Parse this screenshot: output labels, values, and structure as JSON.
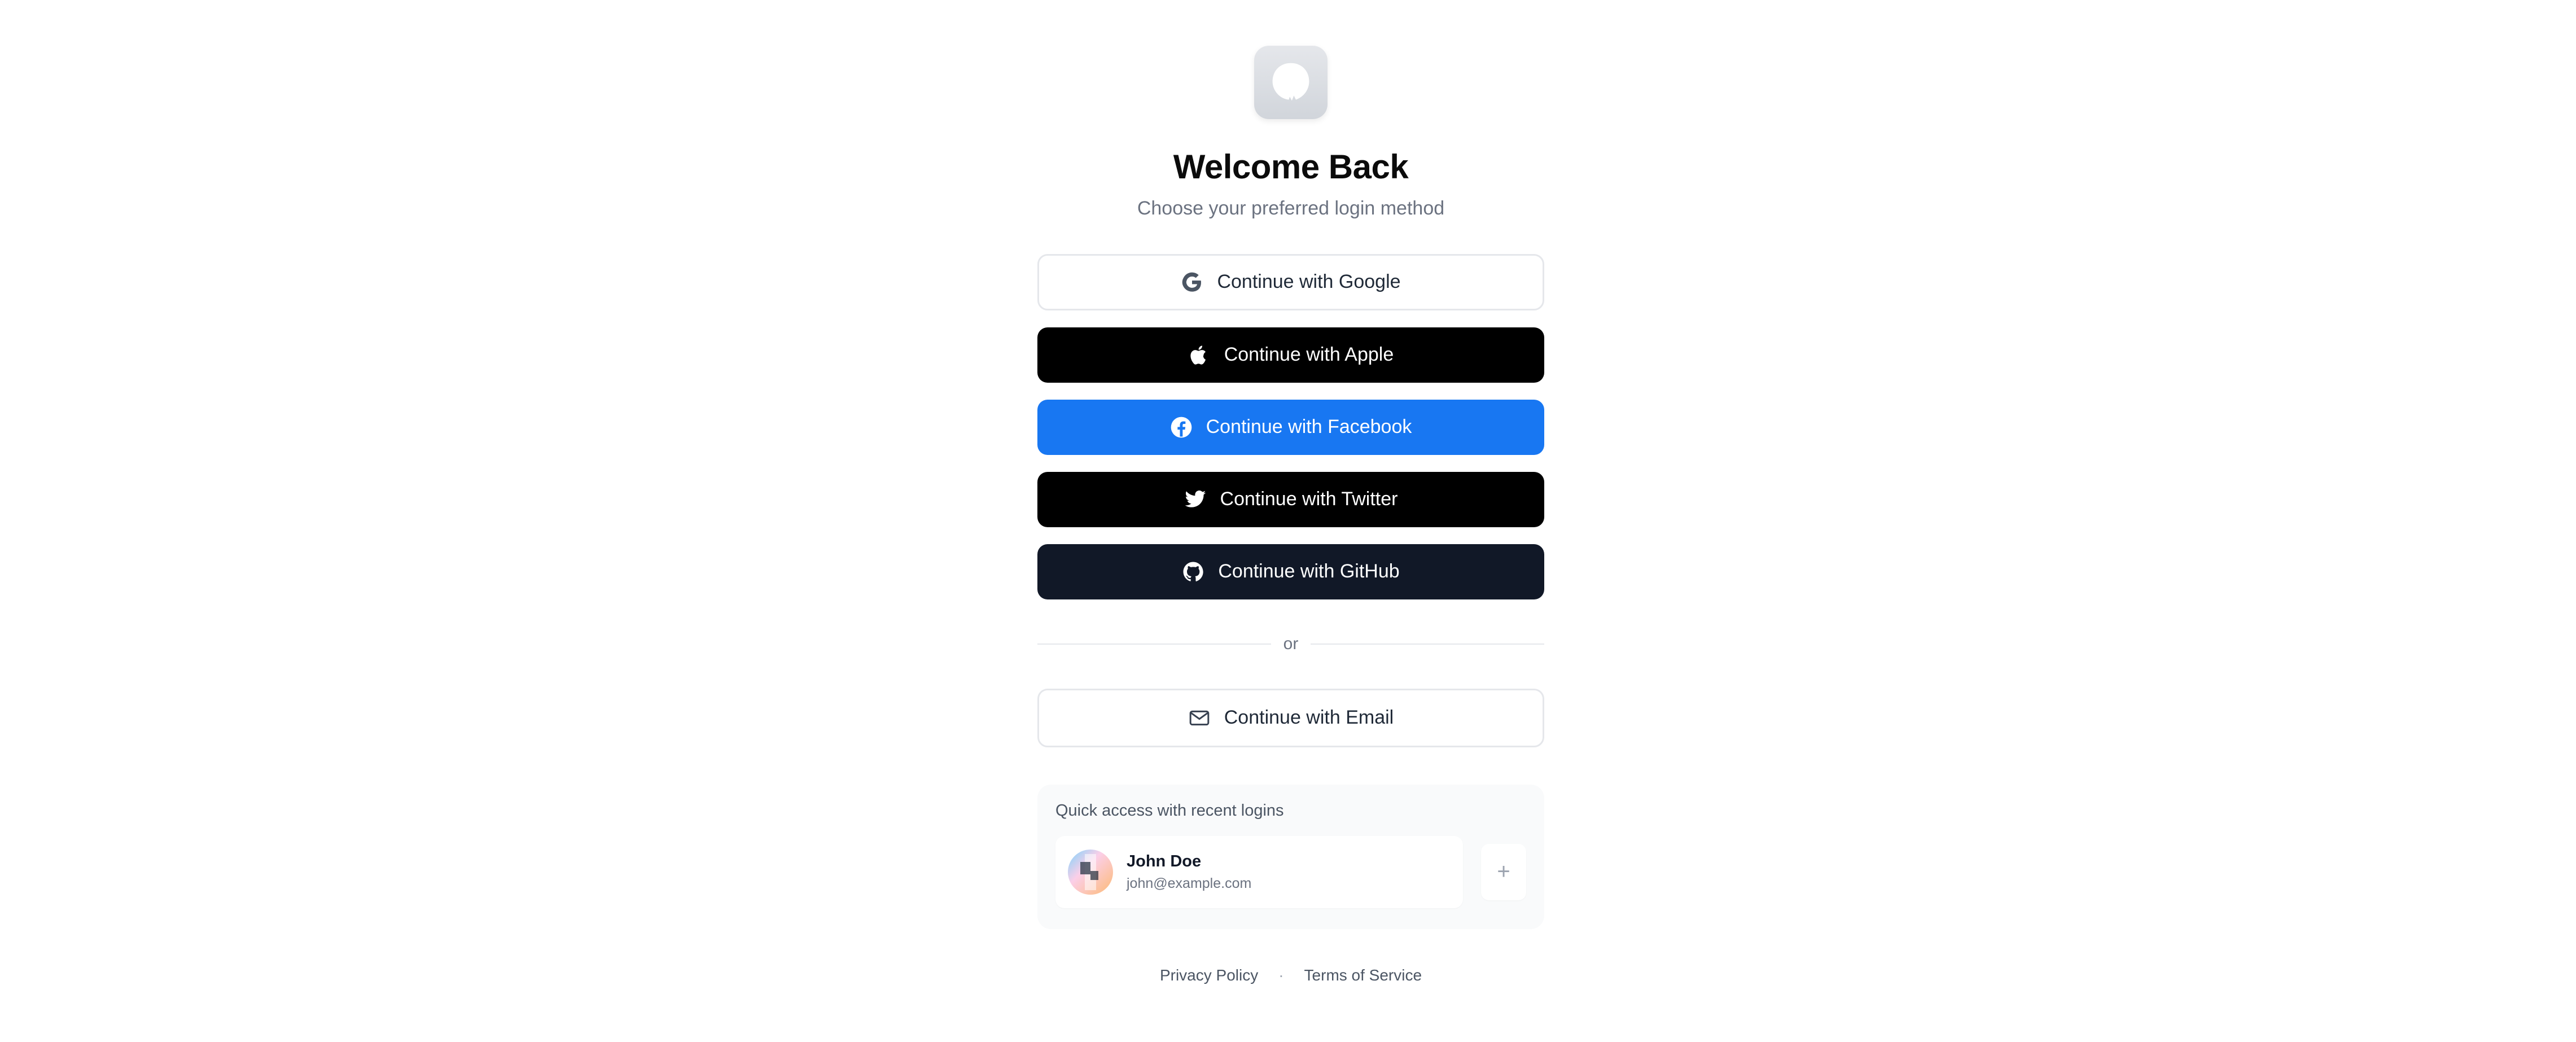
{
  "header": {
    "logo_icon": "app-logo-icon",
    "title": "Welcome Back",
    "subtitle": "Choose your preferred login method"
  },
  "providers": {
    "google": {
      "label": "Continue with Google",
      "icon": "google-icon"
    },
    "apple": {
      "label": "Continue with Apple",
      "icon": "apple-icon"
    },
    "facebook": {
      "label": "Continue with Facebook",
      "icon": "facebook-icon",
      "color": "#1877f2"
    },
    "twitter": {
      "label": "Continue with Twitter",
      "icon": "twitter-icon"
    },
    "github": {
      "label": "Continue with GitHub",
      "icon": "github-icon",
      "color": "#111827"
    }
  },
  "divider": {
    "text": "or"
  },
  "email": {
    "label": "Continue with Email",
    "icon": "mail-icon"
  },
  "recent": {
    "title": "Quick access with recent logins",
    "accounts": [
      {
        "name": "John Doe",
        "email": "john@example.com"
      }
    ],
    "add_symbol": "+"
  },
  "footer": {
    "privacy": "Privacy Policy",
    "separator": "·",
    "terms": "Terms of Service"
  }
}
